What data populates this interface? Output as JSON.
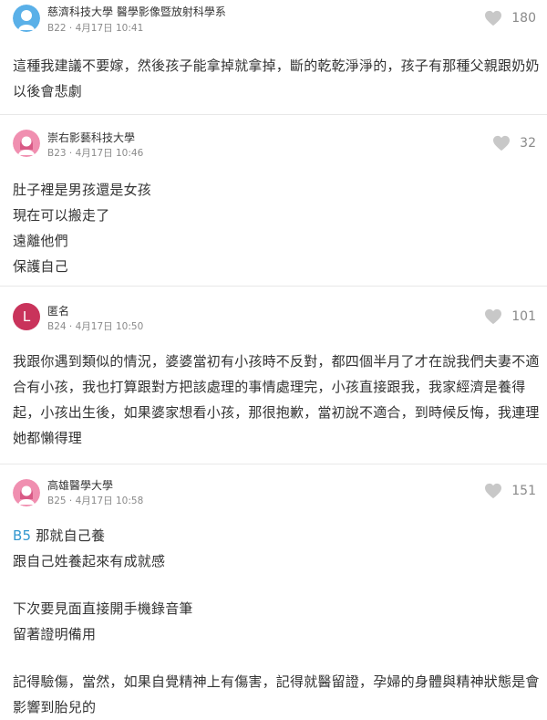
{
  "icons": {
    "heart": "heart-icon",
    "avatar_blue": "avatar-blue",
    "avatar_pink": "avatar-pink"
  },
  "colors": {
    "accent_link": "#3397cf",
    "avatar_blue": "#5ab0e8",
    "avatar_pink": "#f08fb0",
    "avatar_red": "#c9335b"
  },
  "comments": [
    {
      "author": "慈濟科技大學 醫學影像暨放射科學系",
      "floor": "B22",
      "time": "4月17日 10:41",
      "likes": "180",
      "lines": [
        "這種我建議不要嫁，然後孩子能拿掉就拿掉，斷的乾乾淨淨的，孩子有那種父親跟奶奶",
        "以後會悲劇"
      ]
    },
    {
      "author": "崇右影藝科技大學",
      "floor": "B23",
      "time": "4月17日 10:46",
      "likes": "32",
      "lines": [
        "肚子裡是男孩還是女孩",
        "現在可以搬走了",
        "遠離他們",
        "保護自己"
      ]
    },
    {
      "author": "匿名",
      "avatar_letter": "L",
      "floor": "B24",
      "time": "4月17日 10:50",
      "likes": "101",
      "lines": [
        "我跟你遇到類似的情況，婆婆當初有小孩時不反對，都四個半月了才在說我們夫妻不適",
        "合有小孩，我也打算跟對方把該處理的事情處理完，小孩直接跟我，我家經濟是養得",
        "起，小孩出生後，如果婆家想看小孩，那很抱歉，當初說不適合，到時候反悔，我連理",
        "她都懶得理"
      ]
    },
    {
      "author": "高雄醫學大學",
      "floor": "B25",
      "time": "4月17日 10:58",
      "likes": "151",
      "reply_tag": "B5",
      "lines": [
        " 那就自己養",
        "跟自己姓養起來有成就感",
        "下次要見面直接開手機錄音筆",
        "留著證明備用",
        "記得驗傷，當然，如果自覺精神上有傷害，記得就醫留證，孕婦的身體與精神狀態是會",
        "影響到胎兒的"
      ]
    }
  ]
}
